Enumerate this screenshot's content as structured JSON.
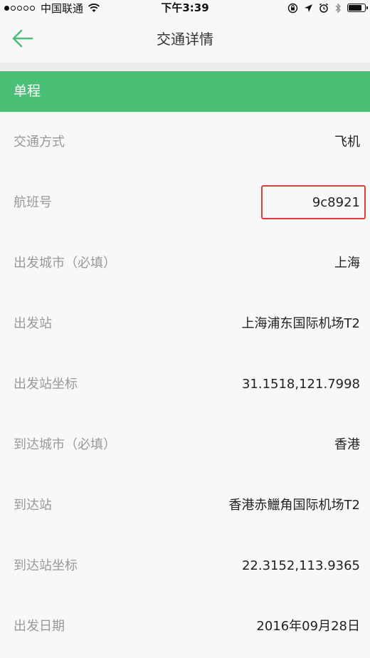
{
  "status_bar": {
    "carrier": "中国联通",
    "time": "下午3:39",
    "signal_filled": 1,
    "battery_level": 0.9
  },
  "nav": {
    "back_icon": "arrow-left-icon",
    "title": "交通详情"
  },
  "section": {
    "title": "单程"
  },
  "details": [
    {
      "label": "交通方式",
      "value": "飞机"
    },
    {
      "label": "航班号",
      "value": "9c8921"
    },
    {
      "label": "出发城市（必填）",
      "value": "上海"
    },
    {
      "label": "出发站",
      "value": "上海浦东国际机场T2"
    },
    {
      "label": "出发站坐标",
      "value": "31.1518,121.7998"
    },
    {
      "label": "到达城市（必填）",
      "value": "香港"
    },
    {
      "label": "到达站",
      "value": "香港赤鱲角国际机场T2"
    },
    {
      "label": "到达站坐标",
      "value": "22.3152,113.9365"
    },
    {
      "label": "出发日期",
      "value": "2016年09月28日"
    }
  ],
  "colors": {
    "accent": "#4bbf75",
    "highlight": "#d9403a"
  }
}
